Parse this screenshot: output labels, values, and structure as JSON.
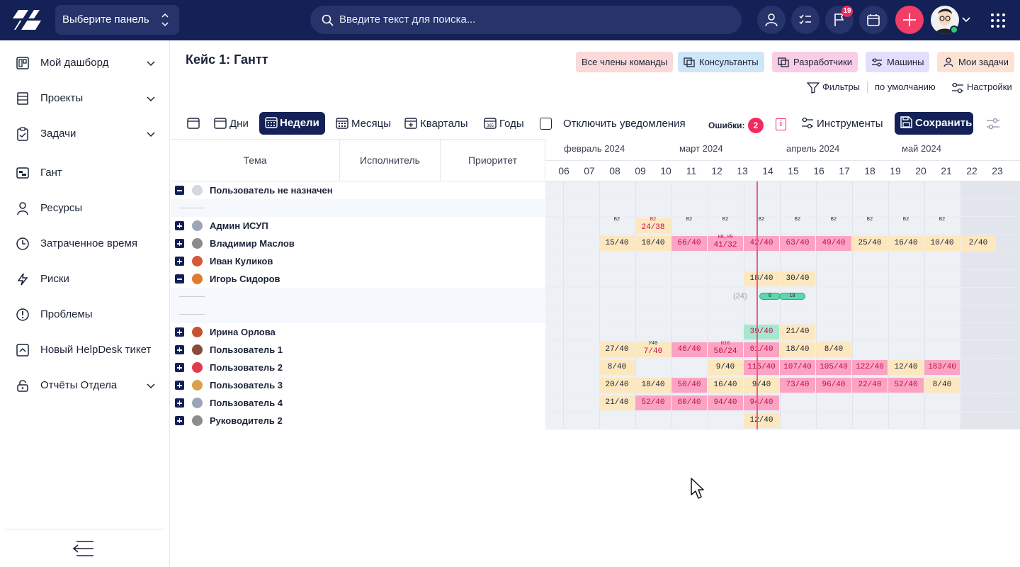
{
  "topbar": {
    "panel_select": "Выберите панель",
    "search_placeholder": "Введите текст для поиска...",
    "notifications_count": "19"
  },
  "sidebar": {
    "items": [
      {
        "label": "Мой дашборд",
        "icon": "dashboard-icon",
        "has_dropdown": true
      },
      {
        "label": "Проекты",
        "icon": "projects-icon",
        "has_dropdown": true
      },
      {
        "label": "Задачи",
        "icon": "tasks-icon",
        "has_dropdown": true
      },
      {
        "label": "Гант",
        "icon": "gantt-icon",
        "has_dropdown": false
      },
      {
        "label": "Ресурсы",
        "icon": "user-icon",
        "has_dropdown": false
      },
      {
        "label": "Затраченное время",
        "icon": "clock-icon",
        "has_dropdown": false
      },
      {
        "label": "Риски",
        "icon": "lightning-icon",
        "has_dropdown": false
      },
      {
        "label": "Проблемы",
        "icon": "alert-icon",
        "has_dropdown": false
      },
      {
        "label": "Новый HelpDesk тикет",
        "icon": "helpdesk-icon",
        "has_dropdown": false
      },
      {
        "label": "Отчёты Отдела",
        "icon": "lock-icon",
        "has_dropdown": true
      }
    ]
  },
  "page": {
    "title": "Кейс 1: Гантт",
    "chips": [
      "Все члены команды",
      "Консультанты",
      "Разработчики",
      "Машины",
      "Мои задачи"
    ],
    "chip_colors": [
      "#fbd9d9",
      "#cfe5f8",
      "#f9cde6",
      "#e3defb",
      "#fce2d3"
    ],
    "filters": "Фильтры",
    "default": "по умолчанию",
    "settings": "Настройки"
  },
  "toolbar": {
    "days": "Дни",
    "weeks": "Недели",
    "months": "Месяцы",
    "quarters": "Кварталы",
    "years": "Годы",
    "disable_notifications": "Отключить уведомления",
    "errors_label": "Ошибки:",
    "errors_count": "2",
    "tools": "Инструменты",
    "save": "Сохранить"
  },
  "gantt": {
    "columns": {
      "topic": "Тема",
      "assignee": "Исполнитель",
      "priority": "Приоритет"
    },
    "months": [
      "февраль 2024",
      "март 2024",
      "апрель 2024",
      "май 2024"
    ],
    "weeks": [
      "06",
      "07",
      "08",
      "09",
      "10",
      "11",
      "12",
      "13",
      "14",
      "15",
      "16",
      "17",
      "18",
      "19",
      "20",
      "21",
      "22",
      "23"
    ],
    "rows": [
      {
        "name": "Пользователь не назначен",
        "toggle": "minus",
        "cells": []
      },
      {
        "name": "",
        "toggle": "",
        "cells": []
      },
      {
        "name": "Админ ИСУП",
        "toggle": "plus",
        "cells": [
          {
            "w": 2,
            "t": "",
            "sup": "В2",
            "c": "t"
          },
          {
            "w": 3,
            "t": "24/38",
            "sup": "В2",
            "c": "y"
          },
          {
            "w": 4,
            "t": "",
            "sup": "В2",
            "c": "t"
          },
          {
            "w": 5,
            "t": "",
            "sup": "В2",
            "c": "t"
          },
          {
            "w": 6,
            "t": "",
            "sup": "В2",
            "c": "t"
          },
          {
            "w": 7,
            "t": "",
            "sup": "В2",
            "c": "t"
          },
          {
            "w": 8,
            "t": "",
            "sup": "В2",
            "c": "t"
          },
          {
            "w": 9,
            "t": "",
            "sup": "В2",
            "c": "t"
          },
          {
            "w": 10,
            "t": "",
            "sup": "В2",
            "c": "t"
          },
          {
            "w": 11,
            "t": "",
            "sup": "В2",
            "c": "t"
          }
        ]
      },
      {
        "name": "Владимир Маслов",
        "toggle": "plus",
        "cells": [
          {
            "w": 2,
            "t": "15/40",
            "c": "y"
          },
          {
            "w": 3,
            "t": "10/40",
            "c": "y"
          },
          {
            "w": 4,
            "t": "66/40",
            "c": "r"
          },
          {
            "w": 5,
            "t": "41/32",
            "sup": "Н8,У8",
            "c": "r"
          },
          {
            "w": 6,
            "t": "42/40",
            "c": "r"
          },
          {
            "w": 7,
            "t": "63/40",
            "c": "r"
          },
          {
            "w": 8,
            "t": "49/40",
            "c": "r"
          },
          {
            "w": 9,
            "t": "25/40",
            "c": "y"
          },
          {
            "w": 10,
            "t": "16/40",
            "c": "y"
          },
          {
            "w": 11,
            "t": "10/40",
            "c": "y"
          },
          {
            "w": 12,
            "t": "2/40",
            "c": "y"
          }
        ]
      },
      {
        "name": "Иван Куликов",
        "toggle": "plus",
        "cells": []
      },
      {
        "name": "Игорь Сидоров",
        "toggle": "minus",
        "cells": [
          {
            "w": 6,
            "t": "18/40",
            "c": "y"
          },
          {
            "w": 7,
            "t": "30/40",
            "c": "y"
          }
        ]
      },
      {
        "name": "",
        "toggle": "",
        "cells": [],
        "sub": {
          "label": "(24)",
          "bars": [
            "6",
            "18"
          ]
        }
      },
      {
        "name": "",
        "toggle": "",
        "cells": []
      },
      {
        "name": "Ирина Орлова",
        "toggle": "plus",
        "cells": [
          {
            "w": 6,
            "t": "39/40",
            "c": "g"
          },
          {
            "w": 7,
            "t": "21/40",
            "c": "y"
          }
        ]
      },
      {
        "name": "Пользователь 1",
        "toggle": "plus",
        "cells": [
          {
            "w": 2,
            "t": "27/40",
            "c": "y"
          },
          {
            "w": 3,
            "t": "7/40",
            "sup": "У40",
            "c": "y"
          },
          {
            "w": 4,
            "t": "46/40",
            "c": "r"
          },
          {
            "w": 5,
            "t": "50/24",
            "sup": "Н16",
            "c": "r"
          },
          {
            "w": 6,
            "t": "61/40",
            "c": "r"
          },
          {
            "w": 7,
            "t": "18/40",
            "c": "y"
          },
          {
            "w": 8,
            "t": "8/40",
            "c": "y"
          }
        ]
      },
      {
        "name": "Пользователь 2",
        "toggle": "plus",
        "cells": [
          {
            "w": 2,
            "t": "8/40",
            "c": "y"
          },
          {
            "w": 5,
            "t": "9/40",
            "c": "y"
          },
          {
            "w": 6,
            "t": "115/40",
            "c": "r"
          },
          {
            "w": 7,
            "t": "107/40",
            "c": "r"
          },
          {
            "w": 8,
            "t": "105/40",
            "c": "r"
          },
          {
            "w": 9,
            "t": "122/40",
            "c": "r"
          },
          {
            "w": 10,
            "t": "12/40",
            "c": "y"
          },
          {
            "w": 11,
            "t": "183/40",
            "c": "r"
          }
        ]
      },
      {
        "name": "Пользователь 3",
        "toggle": "plus",
        "cells": [
          {
            "w": 2,
            "t": "20/40",
            "c": "y"
          },
          {
            "w": 3,
            "t": "18/40",
            "c": "y"
          },
          {
            "w": 4,
            "t": "50/40",
            "c": "r"
          },
          {
            "w": 5,
            "t": "16/40",
            "c": "y"
          },
          {
            "w": 6,
            "t": "9/40",
            "c": "y"
          },
          {
            "w": 7,
            "t": "73/40",
            "c": "r"
          },
          {
            "w": 8,
            "t": "96/40",
            "c": "r"
          },
          {
            "w": 9,
            "t": "22/40",
            "c": "r"
          },
          {
            "w": 10,
            "t": "52/40",
            "c": "r"
          },
          {
            "w": 11,
            "t": "8/40",
            "c": "y"
          }
        ]
      },
      {
        "name": "Пользователь 4",
        "toggle": "plus",
        "cells": [
          {
            "w": 2,
            "t": "21/40",
            "c": "y"
          },
          {
            "w": 3,
            "t": "52/40",
            "c": "r"
          },
          {
            "w": 4,
            "t": "60/40",
            "c": "r"
          },
          {
            "w": 5,
            "t": "94/40",
            "c": "r"
          },
          {
            "w": 6,
            "t": "94/40",
            "c": "r"
          }
        ]
      },
      {
        "name": "Руководитель 2",
        "toggle": "plus",
        "cells": [
          {
            "w": 6,
            "t": "12/40",
            "c": "y"
          }
        ]
      }
    ]
  }
}
